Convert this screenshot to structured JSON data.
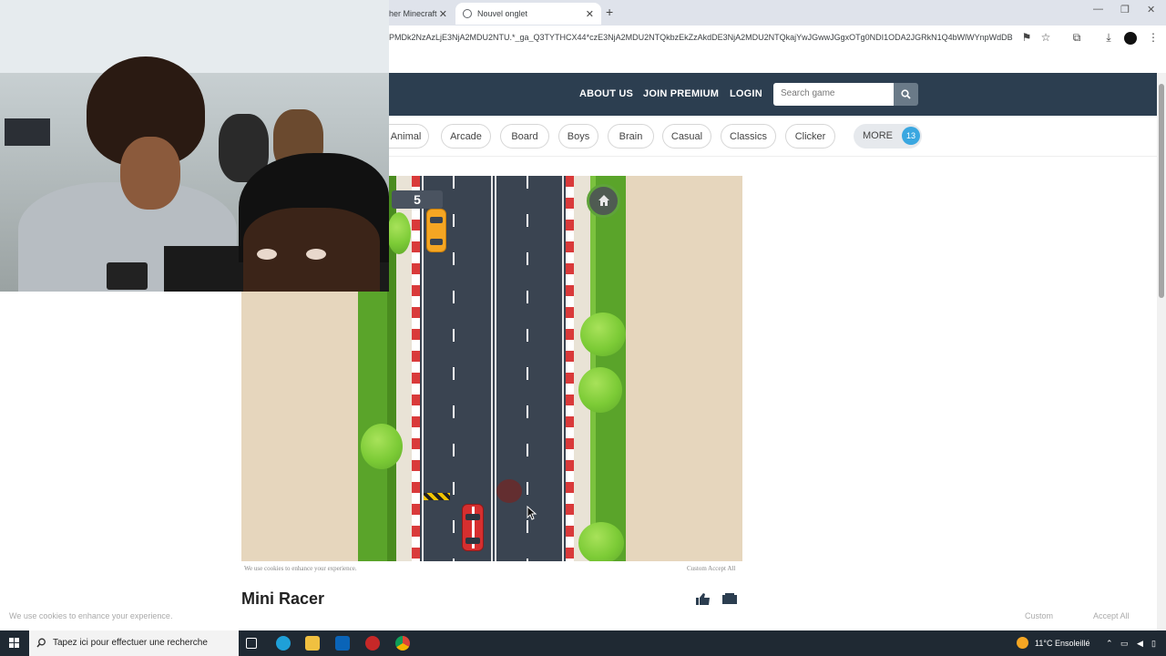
{
  "browser": {
    "tabs": [
      {
        "label": "her Minecraft"
      },
      {
        "label": "Nouvel onglet"
      }
    ],
    "url": "PMDk2NzAzLjE3NjA2MDU2NTU.*_ga_Q3TYTHCX44*czE3NjA2MDU2NTQkbzEkZzAkdDE3NjA2MDU2NTQkajYwJGwwJGgxOTg0NDI1ODA2JGRkN1Q4bWlWYnpWdDBL..."
  },
  "site_nav": {
    "links": [
      "ABOUT US",
      "JOIN PREMIUM",
      "LOGIN"
    ],
    "search_placeholder": "Search game"
  },
  "categories": [
    "Animal",
    "Arcade",
    "Board",
    "Boys",
    "Brain",
    "Casual",
    "Classics",
    "Clicker"
  ],
  "more": {
    "label": "MORE",
    "count": "13"
  },
  "game": {
    "score": "5",
    "cookie_notice": "We use cookies to enhance your experience.",
    "cookie_actions": "Custom  Accept All"
  },
  "page": {
    "title": "Mini Racer"
  },
  "cookie_bar": {
    "text": "We use cookies to enhance your experience.",
    "custom": "Custom",
    "accept": "Accept All"
  },
  "taskbar": {
    "search_text": "Tapez ici pour effectuer une recherche",
    "weather": "11°C  Ensoleillé"
  },
  "colors": {
    "nav_bg": "#2c3e50",
    "badge": "#3aa7e0",
    "road": "#3a4451",
    "grass": "#5aa42a"
  }
}
